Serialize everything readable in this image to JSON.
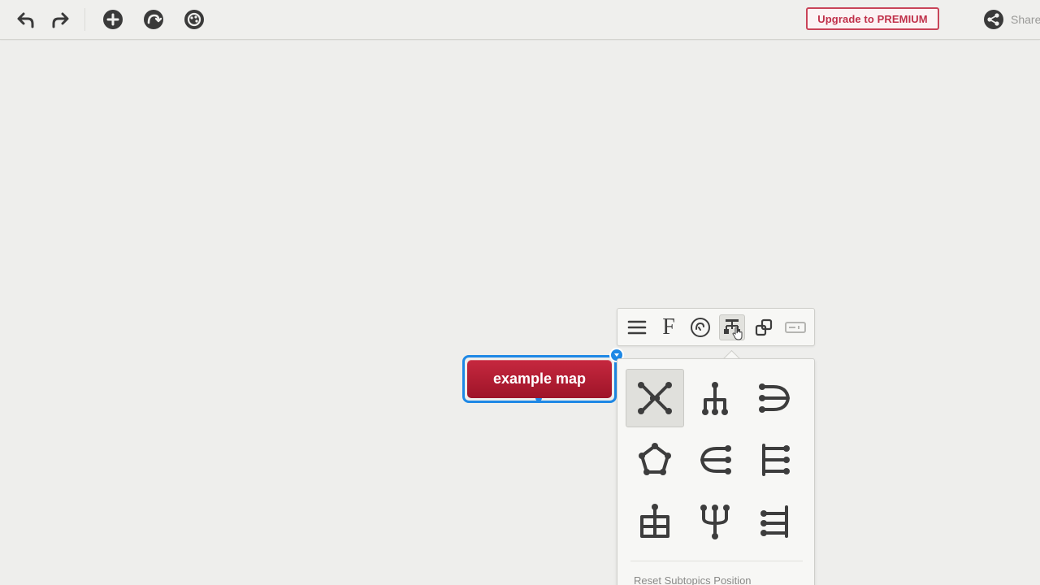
{
  "toolbar": {
    "buttons": [
      {
        "name": "undo-button",
        "icon": "undo-icon"
      },
      {
        "name": "redo-button",
        "icon": "redo-icon"
      },
      {
        "name": "add-topic-button",
        "icon": "add-circle-icon"
      },
      {
        "name": "add-relation-button",
        "icon": "relation-circle-icon"
      },
      {
        "name": "style-button",
        "icon": "palette-circle-icon"
      }
    ],
    "upgrade_label": "Upgrade to PREMIUM",
    "share_label": "Share",
    "icon_color": "#3a3a3a"
  },
  "map": {
    "central_topic": "example map",
    "topic_color": "#b01c33",
    "selection_color": "#1e88e5"
  },
  "format_toolbar": {
    "items": [
      {
        "name": "text-align-icon"
      },
      {
        "name": "font-icon",
        "glyph": "F"
      },
      {
        "name": "color-palette-icon"
      },
      {
        "name": "layout-icon",
        "active": true
      },
      {
        "name": "shape-icon"
      },
      {
        "name": "label-icon"
      }
    ]
  },
  "layout_panel": {
    "options": [
      {
        "name": "layout-mindmap-icon",
        "selected": true
      },
      {
        "name": "layout-org-chart-icon"
      },
      {
        "name": "layout-right-icon"
      },
      {
        "name": "layout-radial-icon"
      },
      {
        "name": "layout-left-icon"
      },
      {
        "name": "layout-list-right-icon"
      },
      {
        "name": "layout-grid-icon"
      },
      {
        "name": "layout-tree-up-icon"
      },
      {
        "name": "layout-list-left-icon"
      }
    ],
    "reset_label": "Reset Subtopics Position"
  }
}
